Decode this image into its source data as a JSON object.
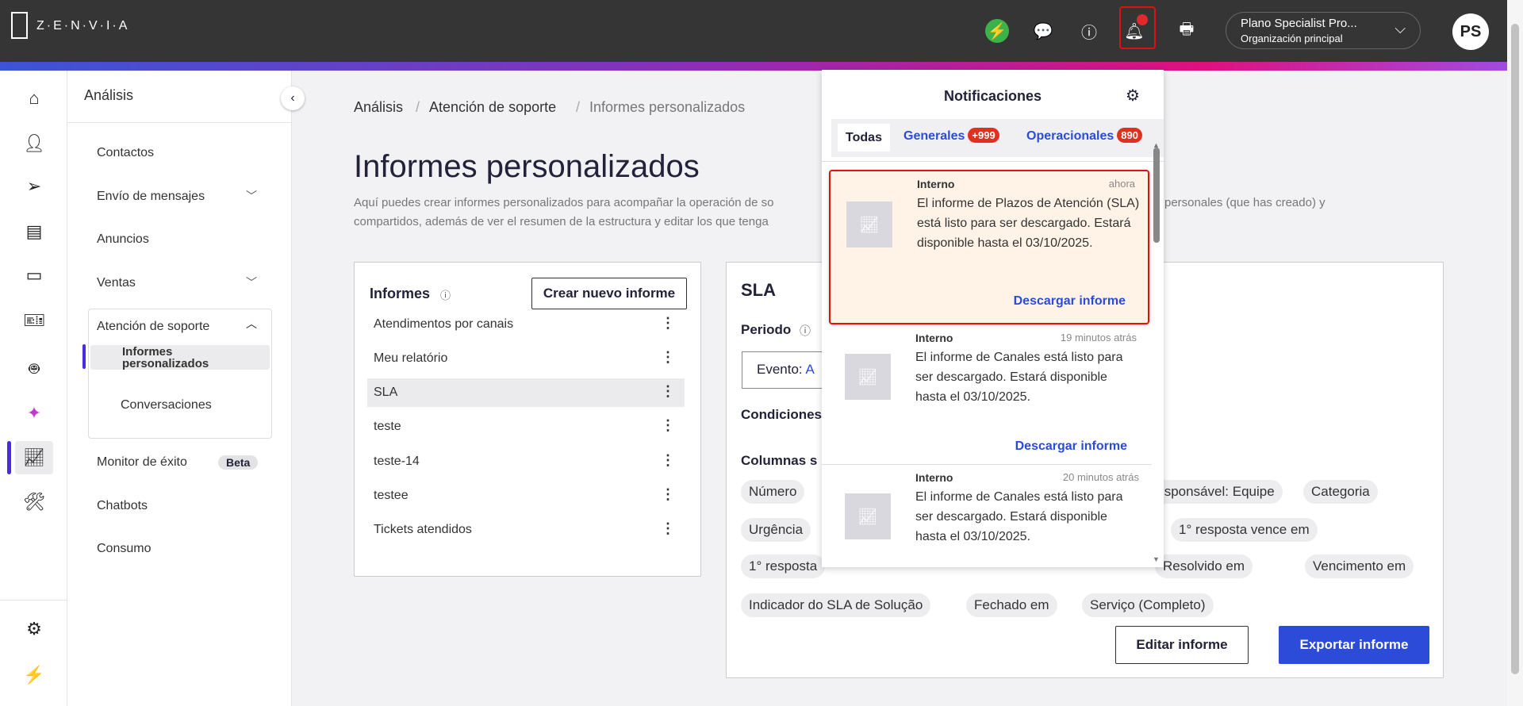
{
  "header": {
    "brand": "Z·E·N·V·I·A",
    "org_name": "Plano Specialist Pro...",
    "org_sub": "Organización principal",
    "avatar": "PS",
    "icons": [
      "bolt-icon",
      "chat-icon",
      "help-icon",
      "bell-icon",
      "printer-icon"
    ],
    "accent": "#2b4bd8"
  },
  "sidebar": {
    "title": "Análisis",
    "items": [
      {
        "label": "Contactos"
      },
      {
        "label": "Envío de mensajes"
      },
      {
        "label": "Anuncios"
      },
      {
        "label": "Ventas"
      },
      {
        "label": "Atención de soporte"
      },
      {
        "label": "Informes personalizados"
      },
      {
        "label": "Conversaciones"
      },
      {
        "label": "Monitor de éxito",
        "badge": "Beta"
      },
      {
        "label": "Chatbots"
      },
      {
        "label": "Consumo"
      }
    ]
  },
  "breadcrumb": [
    "Análisis",
    "Atención de soporte",
    "Informes personalizados"
  ],
  "page": {
    "title": "Informes personalizados",
    "desc1": "Aquí puedes crear informes personalizados para acompañar la operación de so",
    "desc1b": "personales (que has creado) y",
    "desc2": "compartidos, además de ver el resumen de la estructura y editar los que tenga"
  },
  "reports": {
    "title": "Informes",
    "create": "Crear nuevo informe",
    "items": [
      "Atendimentos por canais",
      "Meu relatório",
      "SLA",
      "teste",
      "teste-14",
      "testee",
      "Tickets atendidos"
    ],
    "selected": "SLA"
  },
  "detail": {
    "title": "SLA",
    "period": "Periodo",
    "event_label": "Evento:",
    "event_value": "A",
    "conditions": "Condiciones",
    "columns": "Columnas s",
    "chips": [
      "Número",
      "Responsável: Equipe",
      "Categoria",
      "Urgência",
      "1° resposta vence em",
      "1° resposta",
      "Resolvido em",
      "Vencimento em",
      "Indicador do SLA de Solução",
      "Fechado em",
      "Serviço (Completo)"
    ],
    "edit": "Editar informe",
    "export": "Exportar informe"
  },
  "notifications": {
    "title": "Notificaciones",
    "tabs": [
      {
        "label": "Todas"
      },
      {
        "label": "Generales",
        "count": "+999"
      },
      {
        "label": "Operacionales",
        "count": "890"
      }
    ],
    "items": [
      {
        "source": "Interno",
        "time": "ahora",
        "message": "El informe de Plazos de Atención (SLA) está listo para ser descargado. Estará disponible hasta el 03/10/2025.",
        "action": "Descargar informe"
      },
      {
        "source": "Interno",
        "time": "19 minutos atrás",
        "message": "El informe de Canales está listo para ser descargado. Estará disponible hasta el 03/10/2025.",
        "action": "Descargar informe"
      },
      {
        "source": "Interno",
        "time": "20 minutos atrás",
        "message": "El informe de Canales está listo para ser descargado. Estará disponible hasta el 03/10/2025."
      }
    ]
  }
}
